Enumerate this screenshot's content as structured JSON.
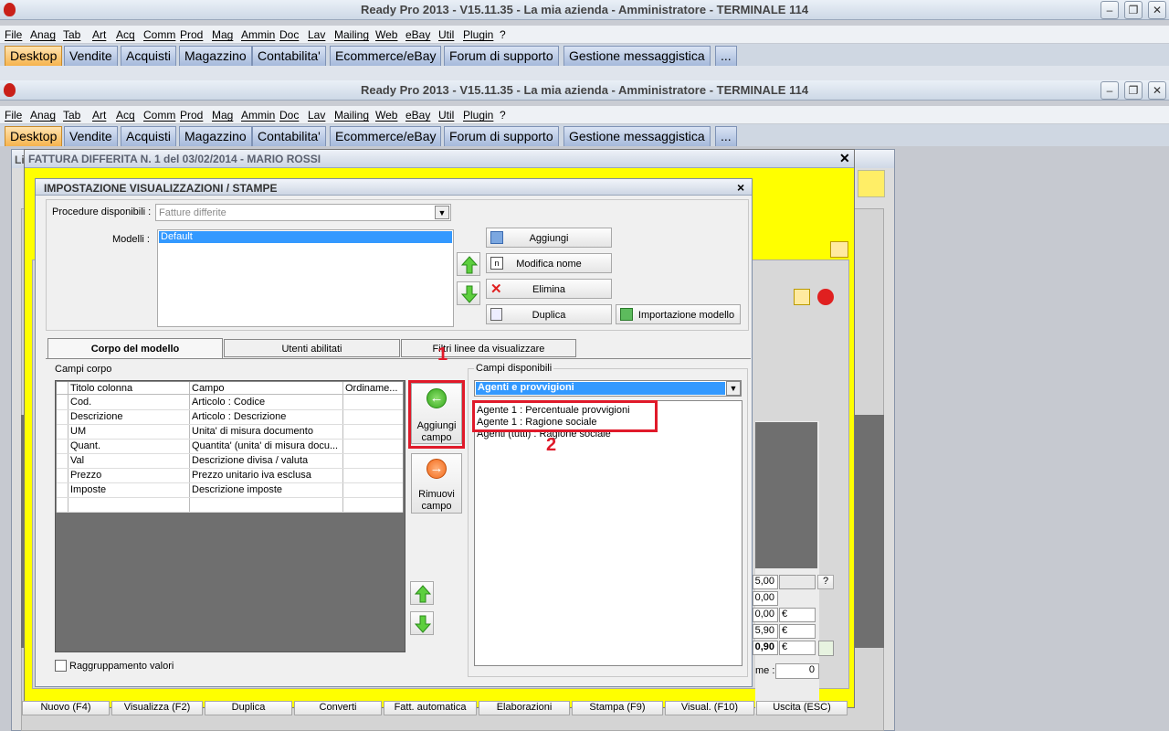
{
  "app_title": "Ready Pro 2013 - V15.11.35 - La mia azienda - Amministratore - TERMINALE 114",
  "menu": [
    "File",
    "Anag",
    "Tab",
    "Art",
    "Acq",
    "Comm",
    "Prod",
    "Mag",
    "Ammin",
    "Doc",
    "Lav",
    "Mailing",
    "Web",
    "eBay",
    "Util",
    "Plugin",
    "?"
  ],
  "tabs": [
    "Desktop",
    "Vendite",
    "Acquisti",
    "Magazzino",
    "Contabilita'",
    "Ecommerce/eBay",
    "Forum di supporto",
    "Gestione messaggistica",
    "..."
  ],
  "invoice_window": {
    "title": "FATTURA DIFFERITA N. 1 del 03/02/2014 - MARIO ROSSI",
    "title_prefix": "Li",
    "right_values": [
      "5,00",
      "0,00",
      "0,00",
      "5,90",
      "0,90"
    ],
    "euro": "€",
    "help": "?",
    "me_label": "me :",
    "me_value": "0",
    "bottom_buttons": [
      "Nuovo (F4)",
      "Visualizza (F2)",
      "Duplica",
      "Converti",
      "Fatt. automatica",
      "Elaborazioni",
      "Stampa (F9)",
      "Visual. (F10)",
      "Uscita (ESC)"
    ]
  },
  "dialog": {
    "title": "IMPOSTAZIONE VISUALIZZAZIONI / STAMPE",
    "close": "×",
    "procedure_label": "Procedure disponibili :",
    "procedure_value": "Fatture differite",
    "models_label": "Modelli :",
    "models": [
      "Default"
    ],
    "buttons": {
      "add": "Aggiungi",
      "rename": "Modifica nome",
      "delete": "Elimina",
      "duplicate": "Duplica",
      "import": "Importazione modello"
    },
    "tabs": [
      "Corpo del modello",
      "Utenti abilitati",
      "Filtri linee da visualizzare"
    ],
    "body_fields_label": "Campi corpo",
    "table": {
      "headers": [
        "Titolo colonna",
        "Campo",
        "Ordiname..."
      ],
      "rows": [
        [
          "Cod.",
          "Articolo : Codice",
          ""
        ],
        [
          "Descrizione",
          "Articolo : Descrizione",
          ""
        ],
        [
          "UM",
          "Unita' di misura documento",
          ""
        ],
        [
          "Quant.",
          "Quantita' (unita' di misura docu...",
          ""
        ],
        [
          "Val",
          "Descrizione divisa / valuta",
          ""
        ],
        [
          "Prezzo",
          "Prezzo unitario iva esclusa",
          ""
        ],
        [
          "Imposte",
          "Descrizione imposte",
          ""
        ],
        [
          "",
          "",
          ""
        ]
      ]
    },
    "add_field": "Aggiungi campo",
    "remove_field": "Rimuovi campo",
    "available_label": "Campi disponibili",
    "available_group": "Agenti e provvigioni",
    "available_fields": [
      "Agente 1 : Percentuale provvigioni",
      "Agente 1 : Ragione sociale",
      "Agenti (tutti) : Ragione sociale"
    ],
    "group_values": "Raggruppamento valori"
  },
  "annotations": [
    "1",
    "2"
  ]
}
